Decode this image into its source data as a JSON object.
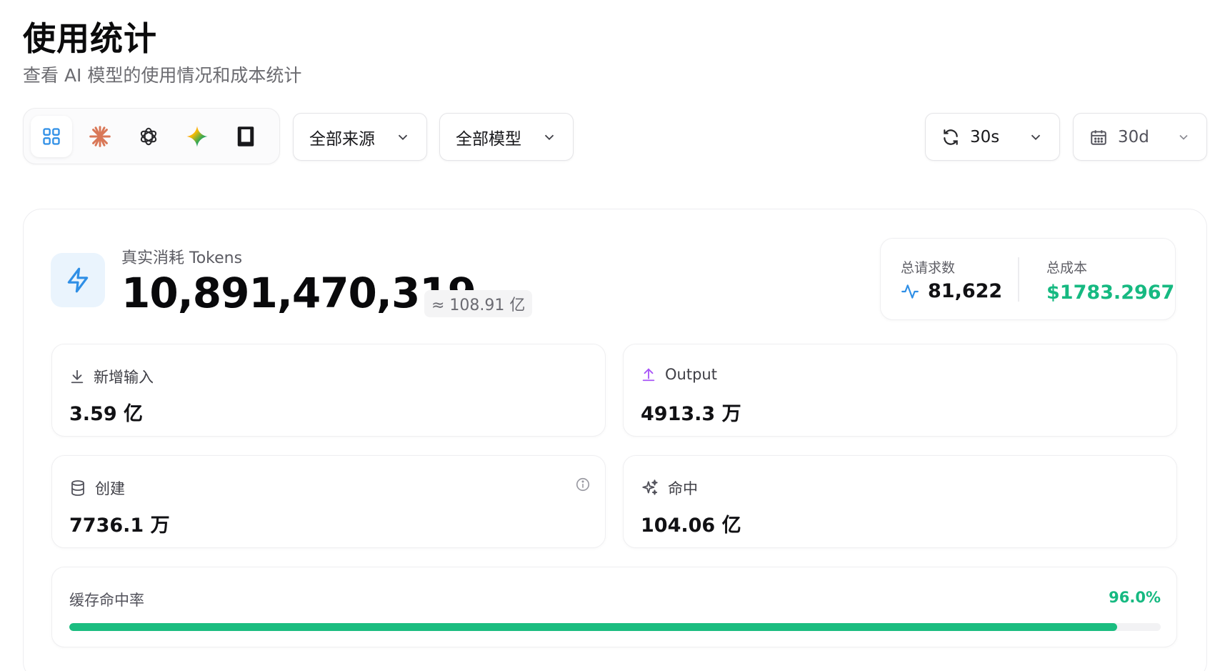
{
  "header": {
    "title": "使用统计",
    "subtitle": "查看 AI 模型的使用情况和成本统计"
  },
  "providers": [
    {
      "name": "all-providers-icon",
      "active": true
    },
    {
      "name": "claude-icon",
      "active": false
    },
    {
      "name": "openai-icon",
      "active": false
    },
    {
      "name": "gemini-icon",
      "active": false
    },
    {
      "name": "kiro-icon",
      "active": false
    }
  ],
  "filters": {
    "source_label": "全部来源",
    "model_label": "全部模型",
    "refresh_label": "30s",
    "range_label": "30d"
  },
  "tokens": {
    "label": "真实消耗 Tokens",
    "value": "10,891,470,319",
    "approx": "≈ 108.91 亿"
  },
  "summary": {
    "requests_label": "总请求数",
    "requests_value": "81,622",
    "cost_label": "总成本",
    "cost_value": "$1783.2967"
  },
  "metrics": {
    "input": {
      "label": "新增输入",
      "value": "3.59 亿"
    },
    "output": {
      "label": "Output",
      "value": "4913.3 万"
    },
    "create": {
      "label": "创建",
      "value": "7736.1 万"
    },
    "hit": {
      "label": "命中",
      "value": "104.06 亿"
    }
  },
  "cache_rate": {
    "label": "缓存命中率",
    "value": "96.0%",
    "fraction": 0.96
  },
  "colors": {
    "accent_blue": "#2f8fe6",
    "success_green": "#16b981",
    "output_purple": "#a855f7",
    "claude_orange": "#d97757"
  }
}
